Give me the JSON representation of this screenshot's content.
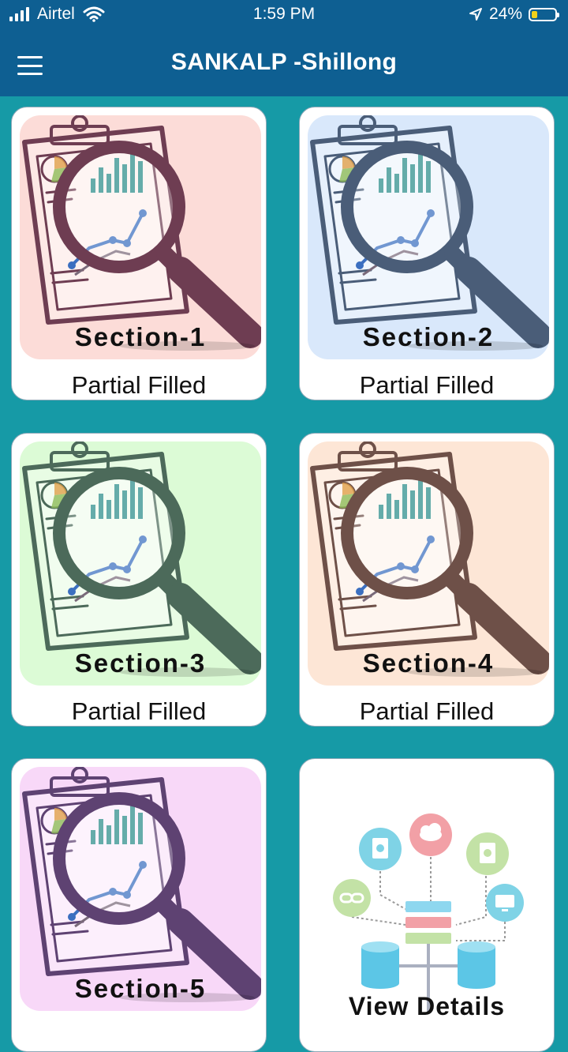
{
  "statusbar": {
    "carrier": "Airtel",
    "time": "1:59 PM",
    "battery": "24%"
  },
  "header": {
    "title": "SANKALP -Shillong"
  },
  "cards": [
    {
      "label": "Section-1",
      "status": "Partial Filled",
      "bg": "#fcdcd8",
      "tint": "#6e3d52"
    },
    {
      "label": "Section-2",
      "status": "Partial Filled",
      "bg": "#d9e8fb",
      "tint": "#4a5d78"
    },
    {
      "label": "Section-3",
      "status": "Partial Filled",
      "bg": "#dcfbd6",
      "tint": "#4c6a5a"
    },
    {
      "label": "Section-4",
      "status": "Partial Filled",
      "bg": "#fde6d6",
      "tint": "#6e5048"
    },
    {
      "label": "Section-5",
      "status": "",
      "bg": "#f8d8f8",
      "tint": "#5e4272"
    }
  ],
  "view_card": {
    "label": "View Details"
  },
  "colors": {
    "header": "#0e5f92",
    "background": "#169aa6",
    "card": "#ffffff"
  }
}
